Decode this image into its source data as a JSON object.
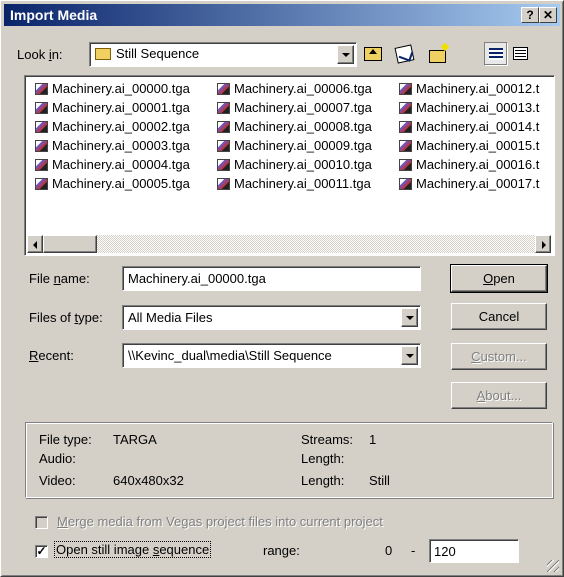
{
  "window": {
    "title": "Import Media",
    "help": "?",
    "close": "✕"
  },
  "look_in": {
    "label_pre": "Look ",
    "label_u": "i",
    "label_post": "n:",
    "value": "Still Sequence"
  },
  "files": [
    "Machinery.ai_00000.tga",
    "Machinery.ai_00001.tga",
    "Machinery.ai_00002.tga",
    "Machinery.ai_00003.tga",
    "Machinery.ai_00004.tga",
    "Machinery.ai_00005.tga",
    "Machinery.ai_00006.tga",
    "Machinery.ai_00007.tga",
    "Machinery.ai_00008.tga",
    "Machinery.ai_00009.tga",
    "Machinery.ai_00010.tga",
    "Machinery.ai_00011.tga",
    "Machinery.ai_00012.t",
    "Machinery.ai_00013.t",
    "Machinery.ai_00014.t",
    "Machinery.ai_00015.t",
    "Machinery.ai_00016.t",
    "Machinery.ai_00017.t"
  ],
  "file_name": {
    "label_pre": "File ",
    "label_u": "n",
    "label_post": "ame:",
    "value": "Machinery.ai_00000.tga"
  },
  "files_of_type": {
    "label_pre": "Files of ",
    "label_u": "t",
    "label_post": "ype:",
    "value": "All Media Files"
  },
  "recent": {
    "label_u": "R",
    "label_post": "ecent:",
    "value": "\\\\Kevinc_dual\\media\\Still Sequence"
  },
  "buttons": {
    "open_u": "O",
    "open_post": "pen",
    "cancel": "Cancel",
    "custom_u": "C",
    "custom_post": "ustom...",
    "about_u": "A",
    "about_post": "bout..."
  },
  "info": {
    "file_type_label": "File type:",
    "file_type_value": "TARGA",
    "audio_label": "Audio:",
    "video_label": "Video:",
    "video_value": "640x480x32",
    "streams_label": "Streams:",
    "streams_value": "1",
    "length_label": "Length:",
    "length2_label": "Length:",
    "length2_value": "Still"
  },
  "merge": {
    "checked": false,
    "label_u": "M",
    "label_post": "erge media from Vegas project files into current project"
  },
  "sequence": {
    "checked": true,
    "check_mark": "✓",
    "label_pre": "Open still image ",
    "label_u": "s",
    "label_post": "equence",
    "range_label": "range:",
    "range_start": "0",
    "range_sep": "-",
    "range_end": "120"
  }
}
